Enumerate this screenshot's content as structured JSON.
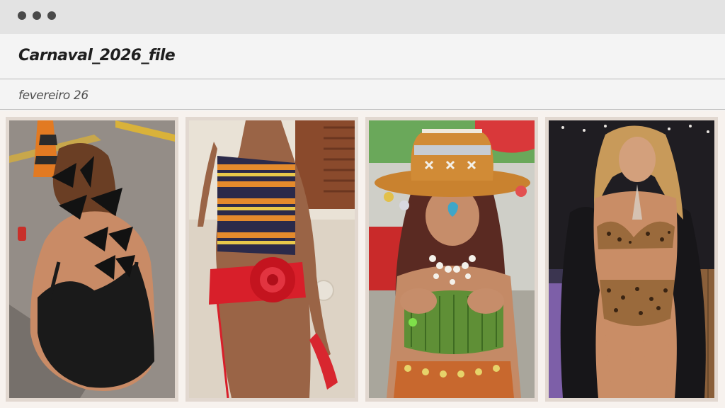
{
  "window": {
    "controls": [
      "window-dot-1",
      "window-dot-2",
      "window-dot-3"
    ]
  },
  "header": {
    "title": "Carnaval_2026_file"
  },
  "subheader": {
    "subtitle": "fevereiro 26"
  },
  "gallery": {
    "photos": [
      {
        "icon": "photo-back-bows"
      },
      {
        "icon": "photo-striped-top"
      },
      {
        "icon": "photo-cowboy-hat"
      },
      {
        "icon": "photo-leopard-set"
      }
    ]
  }
}
